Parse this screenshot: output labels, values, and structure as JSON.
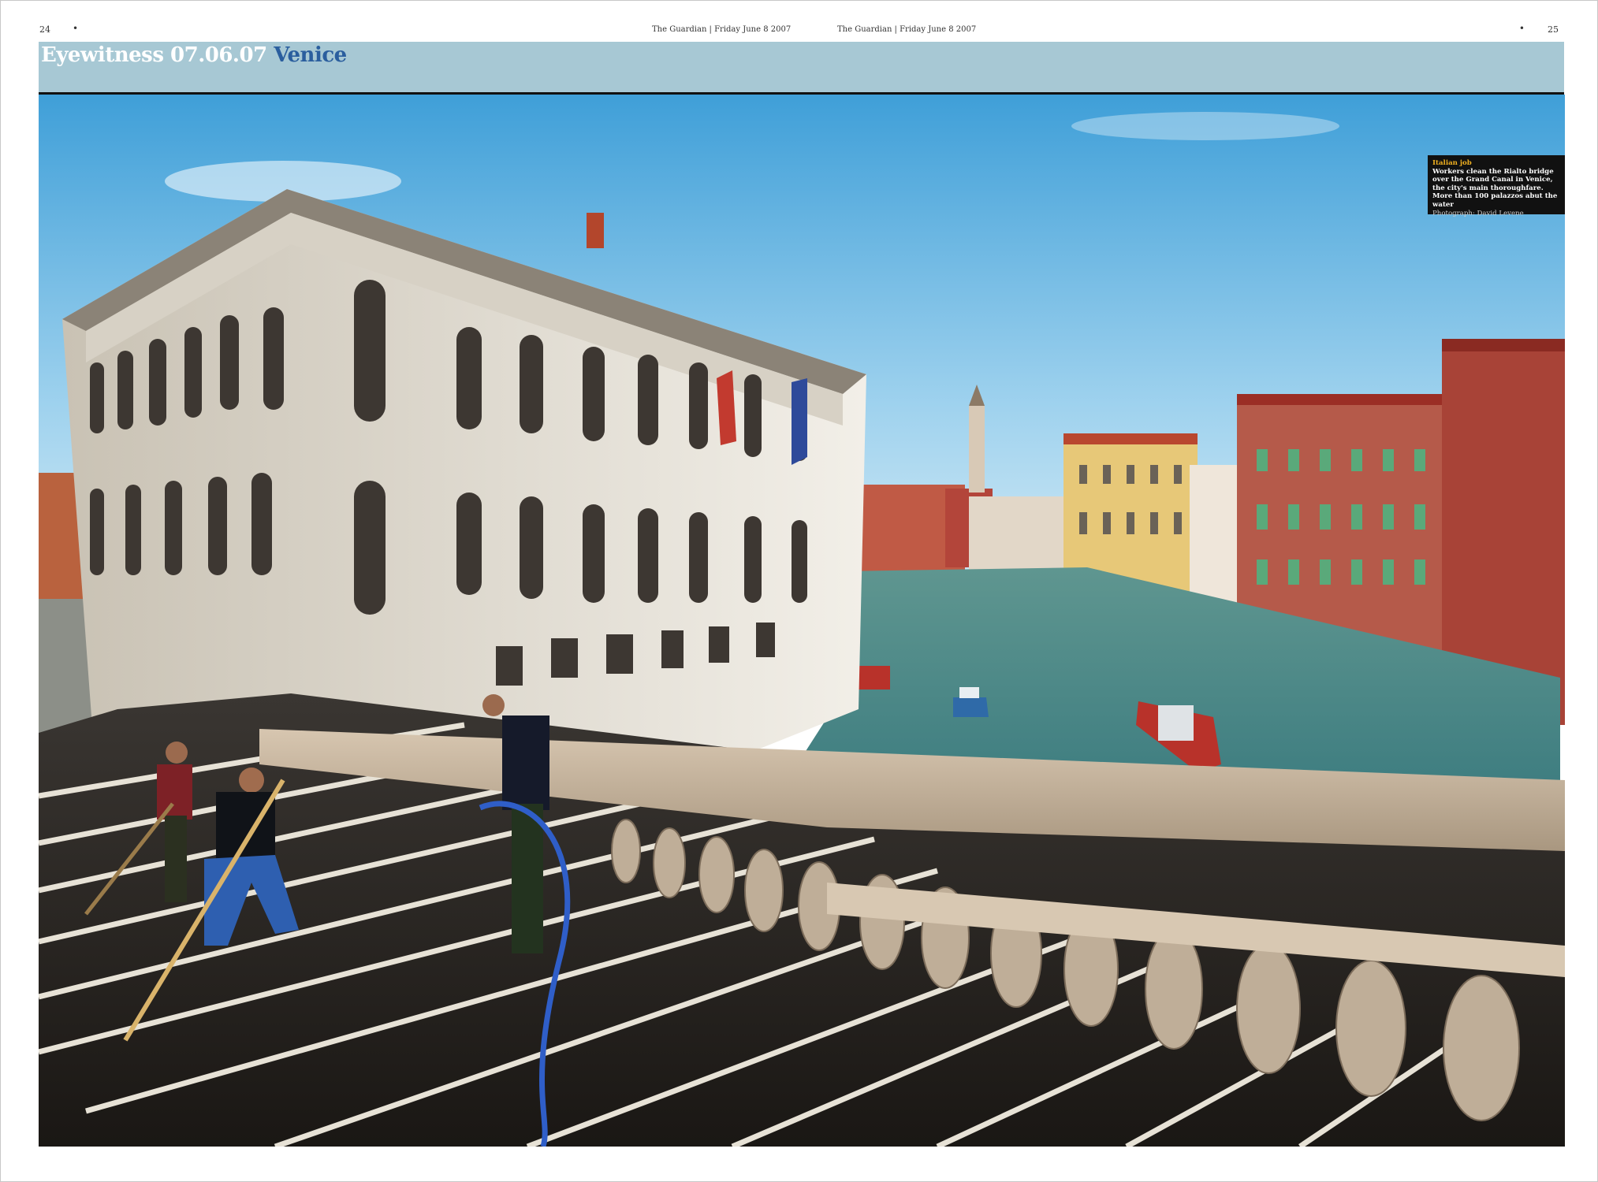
{
  "header": {
    "page_left": "24",
    "page_right": "25",
    "dot": "•",
    "running_left": "The Guardian | Friday June 8 2007",
    "running_right": "The Guardian | Friday June 8 2007"
  },
  "banner": {
    "title": "Eyewitness 07.06.07",
    "place": "Venice",
    "color": "#a7c8d4",
    "place_color": "#2a5e9e"
  },
  "caption": {
    "kicker": "Italian job",
    "body": "Workers clean the Rialto bridge over the Grand Canal in Venice, the city's main thoroughfare. More than 100 palazzos abut the water",
    "credit": "Photograph: David Levene"
  }
}
